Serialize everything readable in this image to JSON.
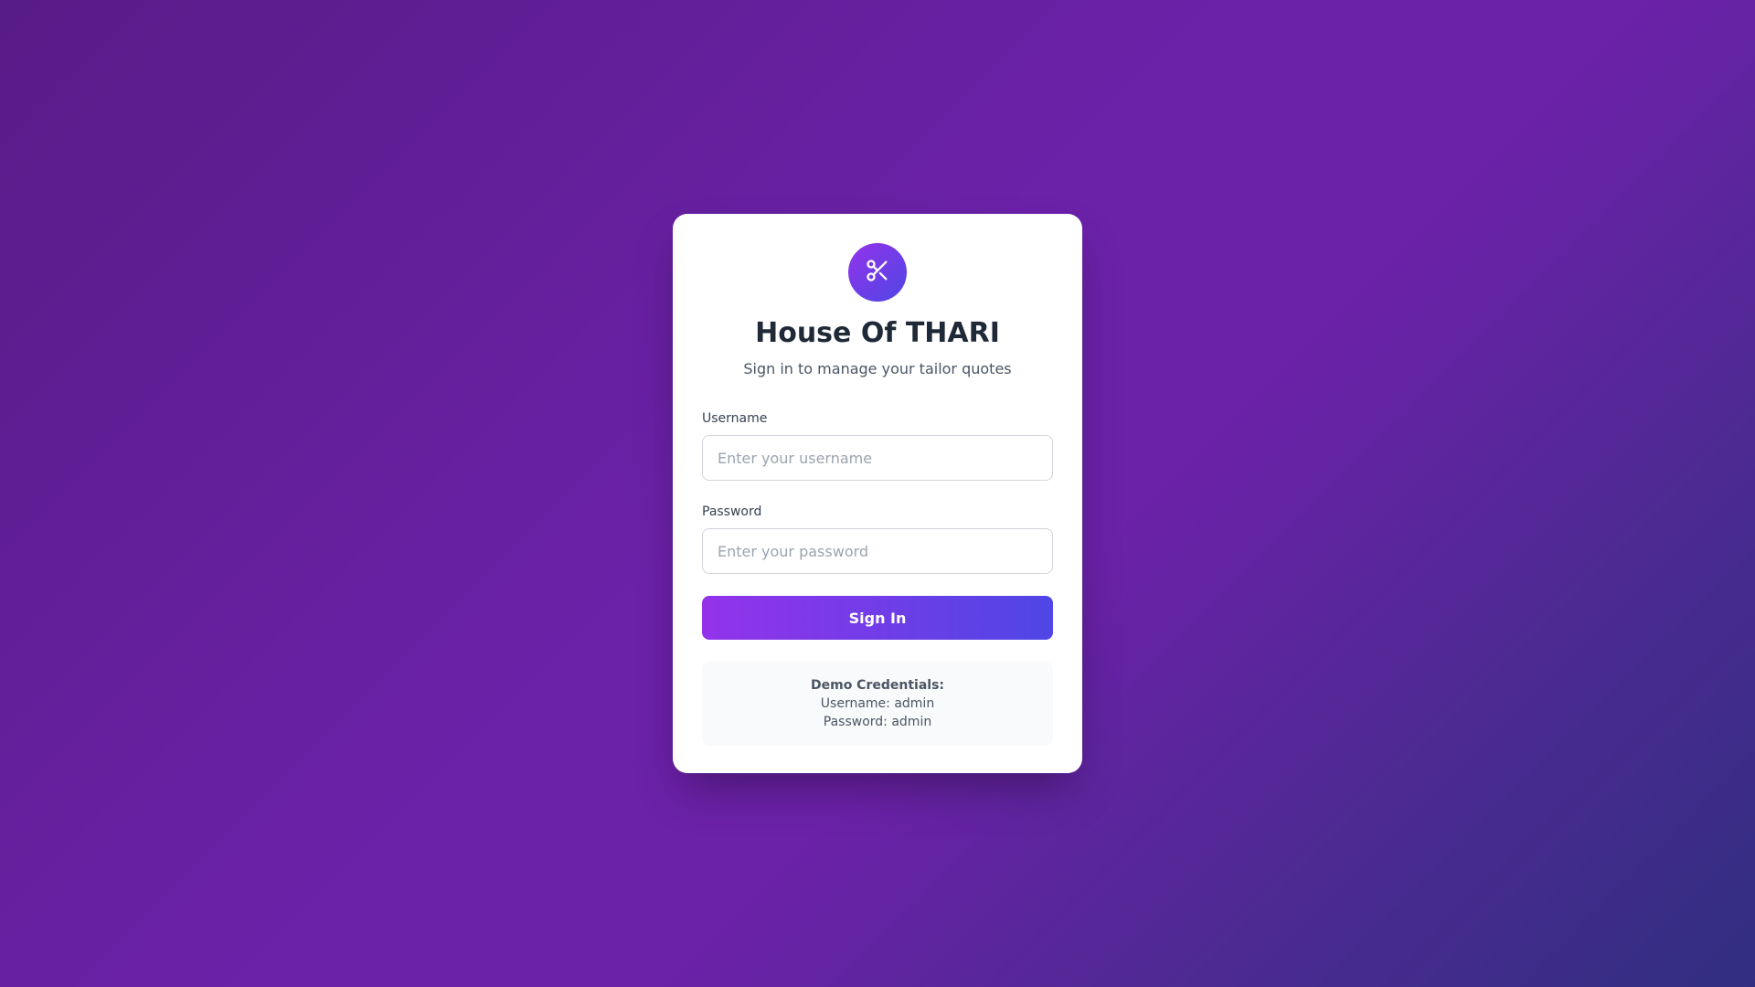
{
  "app": {
    "title": "House Of THARI",
    "subtitle": "Sign in to manage your tailor quotes"
  },
  "logo": {
    "icon": "scissors-icon"
  },
  "form": {
    "username_label": "Username",
    "username_placeholder": "Enter your username",
    "username_value": "",
    "password_label": "Password",
    "password_placeholder": "Enter your password",
    "password_value": "",
    "submit_label": "Sign In"
  },
  "demo": {
    "title": "Demo Credentials:",
    "username_line": "Username: admin",
    "password_line": "Password: admin"
  },
  "colors": {
    "accent_start": "#9333ea",
    "accent_end": "#4f46e5",
    "background_start": "#581c87",
    "background_end": "#312e81"
  }
}
